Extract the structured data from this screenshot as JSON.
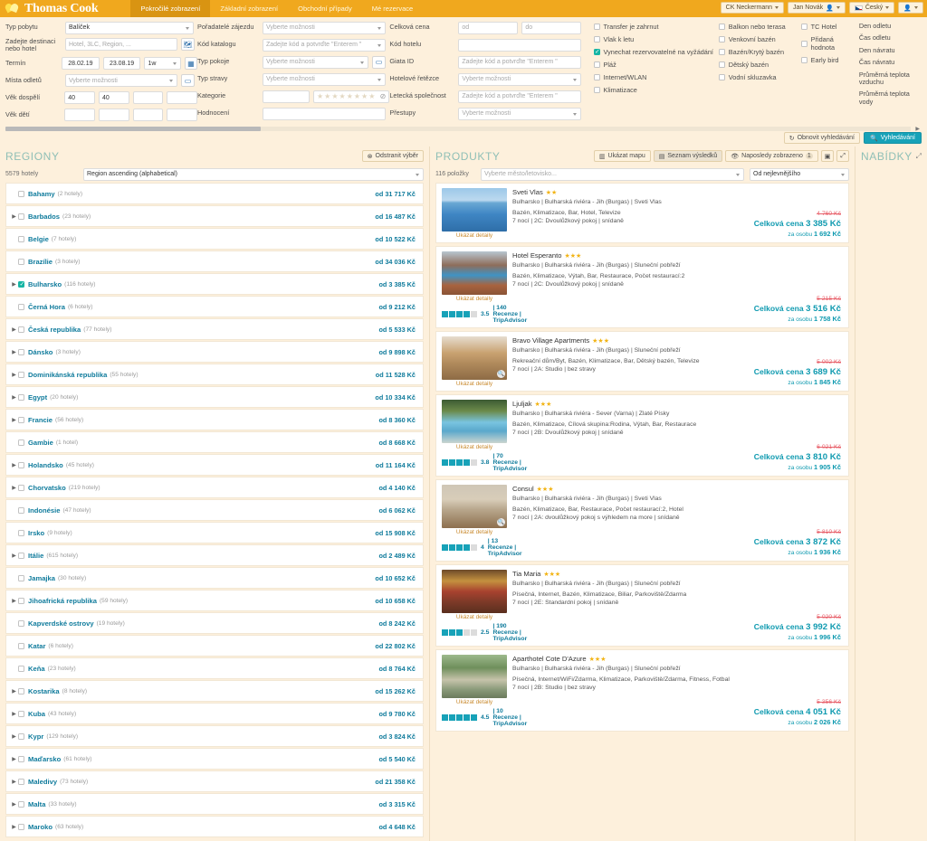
{
  "topbar": {
    "brand": "Thomas Cook",
    "tabs": [
      {
        "label": "Pokročilé zobrazení",
        "active": true
      },
      {
        "label": "Základní zobrazení",
        "active": false
      },
      {
        "label": "Obchodní případy",
        "active": false
      },
      {
        "label": "Mé rezervace",
        "active": false
      }
    ],
    "agency": "CK Neckermann",
    "user": "Jan Novák",
    "language": "Český",
    "accent": "#f0a81e"
  },
  "search": {
    "col1": [
      {
        "label": "Typ pobytu",
        "type": "select",
        "value": "Balíček"
      },
      {
        "label": "Zadejte destinaci nebo hotel",
        "type": "input",
        "placeholder": "Hotel, 3LC, Region, ...",
        "icon": "map-icon"
      },
      {
        "label": "Termín",
        "type": "dates",
        "from": "28.02.19",
        "to": "23.08.19",
        "duration": "1w",
        "icon": "calendar-icon"
      },
      {
        "label": "Místa odletů",
        "type": "select",
        "value": "Vyberte možnosti",
        "icon": "window-icon"
      },
      {
        "label": "Věk dospělí",
        "type": "ages",
        "values": [
          "40",
          "40",
          "",
          ""
        ]
      },
      {
        "label": "Věk dětí",
        "type": "ages",
        "values": [
          "",
          "",
          "",
          ""
        ]
      }
    ],
    "col2": [
      {
        "label": "Pořadatelé zájezdu",
        "type": "select",
        "value": "Vyberte možnosti"
      },
      {
        "label": "Kód katalogu",
        "type": "select",
        "value": "Zadejte kód a potvrďte \"Enterem \""
      },
      {
        "label": "Typ pokoje",
        "type": "select",
        "value": "Vyberte možnosti",
        "icon": "window-icon"
      },
      {
        "label": "Typ stravy",
        "type": "select",
        "value": "Vyberte možnosti"
      },
      {
        "label": "Kategorie",
        "type": "stars",
        "value": ""
      },
      {
        "label": "Hodnocení",
        "type": "input",
        "value": ""
      }
    ],
    "col3": [
      {
        "label": "Celková cena",
        "type": "range",
        "from_ph": "od",
        "to_ph": "do"
      },
      {
        "label": "Kód hotelu",
        "type": "input",
        "value": ""
      },
      {
        "label": "Giata ID",
        "type": "input",
        "placeholder": "Zadejte kód a potvrďte \"Enterem \""
      },
      {
        "label": "Hotelové řetězce",
        "type": "select",
        "value": "Vyberte možnosti"
      },
      {
        "label": "Letecká společnost",
        "type": "input",
        "placeholder": "Zadejte kód a potvrďte \"Enterem \""
      },
      {
        "label": "Přestupy",
        "type": "select",
        "value": "Vyberte možnosti"
      }
    ],
    "checks1": [
      {
        "label": "Transfer je zahrnut",
        "checked": false
      },
      {
        "label": "Vlak k letu",
        "checked": false
      },
      {
        "label": "Vynechat rezervovatelné na vyžádání",
        "checked": true
      },
      {
        "label": "Pláž",
        "checked": false
      },
      {
        "label": "Internet/WLAN",
        "checked": false
      },
      {
        "label": "Klimatizace",
        "checked": false
      }
    ],
    "checks2": [
      {
        "label": "Balkon nebo terasa",
        "checked": false
      },
      {
        "label": "Venkovní bazén",
        "checked": false
      },
      {
        "label": "Bazén/Krytý bazén",
        "checked": false
      },
      {
        "label": "Dětský bazén",
        "checked": false
      },
      {
        "label": "Vodní skluzavka",
        "checked": false
      }
    ],
    "checks3": [
      {
        "label": "TC Hotel",
        "checked": false
      },
      {
        "label": "Přidaná hodnota",
        "checked": false
      },
      {
        "label": "Early bird",
        "checked": false
      }
    ],
    "right_labels": [
      "Den odletu",
      "Čas odletu",
      "Den návratu",
      "Čas návratu",
      "Průměrná teplota vzduchu",
      "Průměrná teplota vody"
    ],
    "refresh_label": "Obnovit vyhledávání",
    "search_label": "Vyhledávání"
  },
  "regions": {
    "title": "REGIONY",
    "clear_label": "Odstranit výběr",
    "count": "5579 hotely",
    "sort": "Region ascending (alphabetical)",
    "items": [
      {
        "name": "Bahamy",
        "count": "(2 hotely)",
        "price": "od 31 717 Kč",
        "expandable": false,
        "checked": false
      },
      {
        "name": "Barbados",
        "count": "(23 hotely)",
        "price": "od 16 487 Kč",
        "expandable": true,
        "checked": false
      },
      {
        "name": "Belgie",
        "count": "(7 hotely)",
        "price": "od 10 522 Kč",
        "expandable": false,
        "checked": false
      },
      {
        "name": "Brazílie",
        "count": "(3 hotely)",
        "price": "od 34 036 Kč",
        "expandable": false,
        "checked": false
      },
      {
        "name": "Bulharsko",
        "count": "(116 hotely)",
        "price": "od 3 385 Kč",
        "expandable": true,
        "checked": true
      },
      {
        "name": "Černá Hora",
        "count": "(6 hotely)",
        "price": "od 9 212 Kč",
        "expandable": false,
        "checked": false
      },
      {
        "name": "Česká republika",
        "count": "(77 hotely)",
        "price": "od 5 533 Kč",
        "expandable": true,
        "checked": false
      },
      {
        "name": "Dánsko",
        "count": "(3 hotely)",
        "price": "od 9 898 Kč",
        "expandable": true,
        "checked": false
      },
      {
        "name": "Dominikánská republika",
        "count": "(55 hotely)",
        "price": "od 11 528 Kč",
        "expandable": true,
        "checked": false
      },
      {
        "name": "Egypt",
        "count": "(20 hotely)",
        "price": "od 10 334 Kč",
        "expandable": true,
        "checked": false
      },
      {
        "name": "Francie",
        "count": "(56 hotely)",
        "price": "od 8 360 Kč",
        "expandable": true,
        "checked": false
      },
      {
        "name": "Gambie",
        "count": "(1 hotel)",
        "price": "od 8 668 Kč",
        "expandable": false,
        "checked": false
      },
      {
        "name": "Holandsko",
        "count": "(45 hotely)",
        "price": "od 11 164 Kč",
        "expandable": true,
        "checked": false
      },
      {
        "name": "Chorvatsko",
        "count": "(219 hotely)",
        "price": "od 4 140 Kč",
        "expandable": true,
        "checked": false
      },
      {
        "name": "Indonésie",
        "count": "(47 hotely)",
        "price": "od 6 062 Kč",
        "expandable": false,
        "checked": false
      },
      {
        "name": "Irsko",
        "count": "(9 hotely)",
        "price": "od 15 908 Kč",
        "expandable": false,
        "checked": false
      },
      {
        "name": "Itálie",
        "count": "(615 hotely)",
        "price": "od 2 489 Kč",
        "expandable": true,
        "checked": false
      },
      {
        "name": "Jamajka",
        "count": "(30 hotely)",
        "price": "od 10 652 Kč",
        "expandable": false,
        "checked": false
      },
      {
        "name": "Jihoafrická republika",
        "count": "(59 hotely)",
        "price": "od 10 658 Kč",
        "expandable": true,
        "checked": false
      },
      {
        "name": "Kapverdské ostrovy",
        "count": "(19 hotely)",
        "price": "od 8 242 Kč",
        "expandable": false,
        "checked": false
      },
      {
        "name": "Katar",
        "count": "(6 hotely)",
        "price": "od 22 802 Kč",
        "expandable": false,
        "checked": false
      },
      {
        "name": "Keňa",
        "count": "(23 hotely)",
        "price": "od 8 764 Kč",
        "expandable": false,
        "checked": false
      },
      {
        "name": "Kostarika",
        "count": "(8 hotely)",
        "price": "od 15 262 Kč",
        "expandable": true,
        "checked": false
      },
      {
        "name": "Kuba",
        "count": "(43 hotely)",
        "price": "od 9 780 Kč",
        "expandable": true,
        "checked": false
      },
      {
        "name": "Kypr",
        "count": "(129 hotely)",
        "price": "od 3 824 Kč",
        "expandable": true,
        "checked": false
      },
      {
        "name": "Maďarsko",
        "count": "(61 hotely)",
        "price": "od 5 540 Kč",
        "expandable": true,
        "checked": false
      },
      {
        "name": "Maledivy",
        "count": "(73 hotely)",
        "price": "od 21 358 Kč",
        "expandable": true,
        "checked": false
      },
      {
        "name": "Malta",
        "count": "(33 hotely)",
        "price": "od 3 315 Kč",
        "expandable": true,
        "checked": false
      },
      {
        "name": "Maroko",
        "count": "(63 hotely)",
        "price": "od 4 648 Kč",
        "expandable": true,
        "checked": false
      }
    ]
  },
  "products": {
    "title": "PRODUKTY",
    "map_label": "Ukázat mapu",
    "list_label": "Seznam výsledků",
    "recent_label": "Naposledy zobrazeno",
    "recent_count": "1",
    "count": "116 položky",
    "city_filter": "Vyberte město/letovisko...",
    "sort": "Od nejlevnějšího",
    "items": [
      {
        "name": "Sveti Vlas",
        "stars": 2,
        "location": "Bulharsko | Bulharská riviéra - Jih (Burgas) | Sveti Vlas",
        "facilities": "Bazén, Klimatizace, Bar, Hotel, Televize",
        "room": "7 nocí | 2C: Dvoulůžkový pokoj | snídaně",
        "detail_label": "Ukázat detaily",
        "old_price": "4 760 Kč",
        "total_label": "Celková cena",
        "total_price": "3 385 Kč",
        "per_label": "za osobu",
        "per_price": "1 692 Kč",
        "rating": null,
        "reviews": null,
        "review_src": null,
        "thumb": "pool-resort"
      },
      {
        "name": "Hotel Esperanto",
        "stars": 3,
        "location": "Bulharsko | Bulharská riviéra - Jih (Burgas) | Sluneční pobřeží",
        "facilities": "Bazén, Klimatizace, Výtah, Bar, Restaurace, Počet restaurací:2",
        "room": "7 nocí | 2C: Dvoulůžkový pokoj | snídaně",
        "detail_label": "Ukázat detaily",
        "old_price": "5 215 Kč",
        "total_label": "Celková cena",
        "total_price": "3 516 Kč",
        "per_label": "za osobu",
        "per_price": "1 758 Kč",
        "rating": "3.5",
        "reviews": "140 Recenze",
        "review_src": "TripAdvisor",
        "rating_bars": 3.5,
        "thumb": "round-pool"
      },
      {
        "name": "Bravo Village Apartments",
        "stars": 3,
        "location": "Bulharsko | Bulharská riviéra - Jih (Burgas) | Sluneční pobřeží",
        "facilities": "Rekreační dům/Byt, Bazén, Klimatizace, Bar, Dětský bazén, Televize",
        "room": "7 nocí | 2A: Studio | bez stravy",
        "detail_label": "Ukázat detaily",
        "old_price": "5 002 Kč",
        "total_label": "Celková cena",
        "total_price": "3 689 Kč",
        "per_label": "za osobu",
        "per_price": "1 845 Kč",
        "rating": null,
        "reviews": null,
        "review_src": null,
        "thumb": "kitchen"
      },
      {
        "name": "Ljuljak",
        "stars": 3,
        "location": "Bulharsko | Bulharská riviéra - Sever (Varna) | Zlaté Písky",
        "facilities": "Bazén, Klimatizace, Cílová skupina:Rodina, Výtah, Bar, Restaurace",
        "room": "7 nocí | 2B: Dvoulůžkový pokoj | snídaně",
        "detail_label": "Ukázat detaily",
        "old_price": "6 021 Kč",
        "total_label": "Celková cena",
        "total_price": "3 810 Kč",
        "per_label": "za osobu",
        "per_price": "1 905 Kč",
        "rating": "3.8",
        "reviews": "70 Recenze",
        "review_src": "TripAdvisor",
        "rating_bars": 3.8,
        "thumb": "garden-pool"
      },
      {
        "name": "Consul",
        "stars": 3,
        "location": "Bulharsko | Bulharská riviéra - Jih (Burgas) | Sveti Vlas",
        "facilities": "Bazén, Klimatizace, Bar, Restaurace, Počet restaurací:2, Hotel",
        "room": "7 nocí | 2A: dvoulůžkový pokoj s výhledem na more | snídaně",
        "detail_label": "Ukázat detaily",
        "old_price": "5 810 Kč",
        "total_label": "Celková cena",
        "total_price": "3 872 Kč",
        "per_label": "za osobu",
        "per_price": "1 936 Kč",
        "rating": "4",
        "reviews": "13 Recenze",
        "review_src": "TripAdvisor",
        "rating_bars": 4,
        "thumb": "room"
      },
      {
        "name": "Tia Maria",
        "stars": 3,
        "location": "Bulharsko | Bulharská riviéra - Jih (Burgas) | Sluneční pobřeží",
        "facilities": "Písečná, Internet, Bazén, Klimatizace, Biliar, Parkoviště/Zdarma",
        "room": "7 nocí | 2E: Standardní pokoj | snídaně",
        "detail_label": "Ukázat detaily",
        "old_price": "5 020 Kč",
        "total_label": "Celková cena",
        "total_price": "3 992 Kč",
        "per_label": "za osobu",
        "per_price": "1 996 Kč",
        "rating": "2.5",
        "reviews": "190 Recenze",
        "review_src": "TripAdvisor",
        "rating_bars": 2.5,
        "thumb": "food"
      },
      {
        "name": "Aparthotel Cote D'Azure",
        "stars": 3,
        "location": "Bulharsko | Bulharská riviéra - Jih (Burgas) | Sluneční pobřeží",
        "facilities": "Písečná, Internet/WiFi/Zdarma, Klimatizace, Parkoviště/Zdarma, Fitness, Fotbal",
        "room": "7 nocí | 2B: Studio | bez stravy",
        "detail_label": "Ukázat detaily",
        "old_price": "5 356 Kč",
        "total_label": "Celková cena",
        "total_price": "4 051 Kč",
        "per_label": "za osobu",
        "per_price": "2 026 Kč",
        "rating": "4.5",
        "reviews": "10 Recenze",
        "review_src": "TripAdvisor",
        "rating_bars": 4.5,
        "thumb": "street"
      }
    ]
  },
  "offers": {
    "title": "NABÍDKY"
  }
}
